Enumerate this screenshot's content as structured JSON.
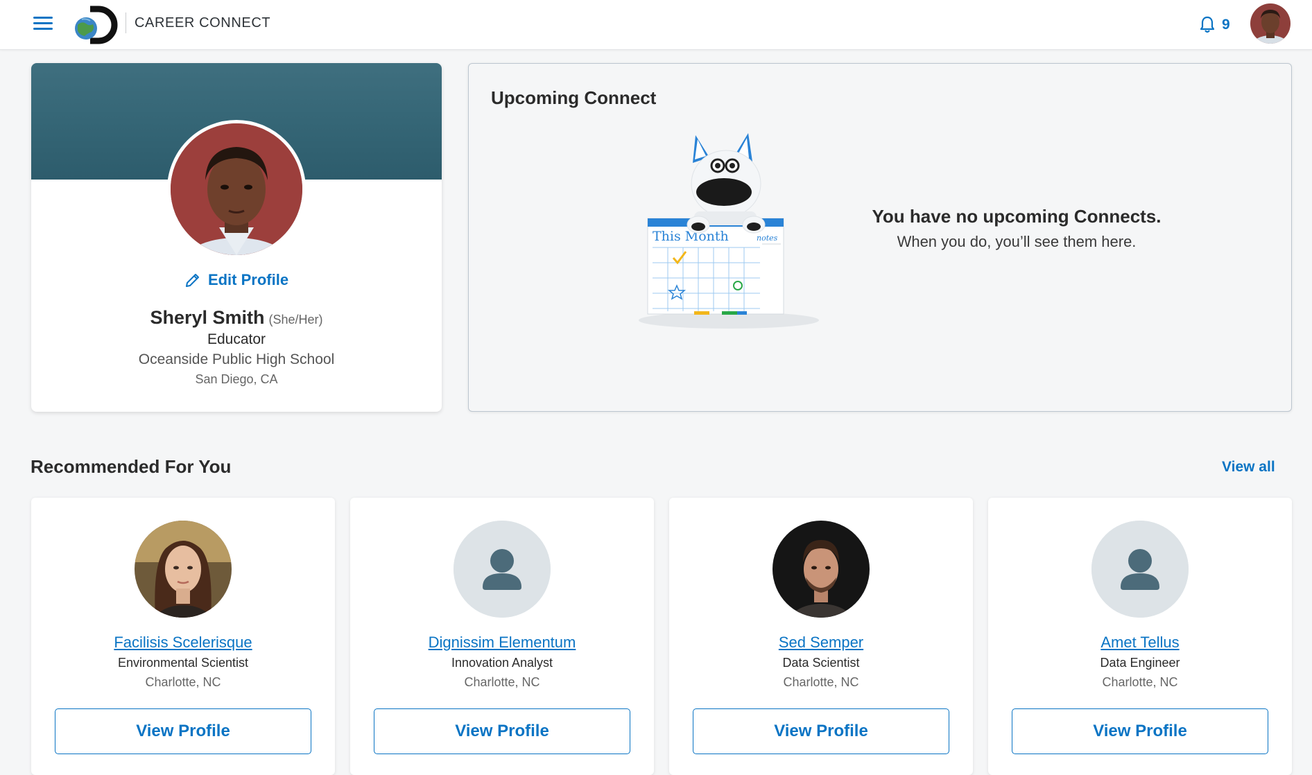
{
  "header": {
    "brand_name": "CAREER CONNECT",
    "notification_count": "9",
    "accent_color": "#0a74c4"
  },
  "profile": {
    "edit_label": "Edit Profile",
    "name": "Sheryl Smith",
    "pronouns": "(She/Her)",
    "role": "Educator",
    "school": "Oceanside Public High School",
    "location": "San Diego, CA"
  },
  "upcoming": {
    "title": "Upcoming Connect",
    "illustration_calendar_label": "This Month",
    "illustration_notes_label": "notes",
    "empty_title": "You have no upcoming Connects.",
    "empty_subtitle": "When you do, you’ll see them here."
  },
  "recommended": {
    "title": "Recommended For You",
    "view_all": "View all",
    "cards": [
      {
        "name": "Facilisis Scelerisque",
        "role": "Environmental Scientist",
        "location": "Charlotte, NC",
        "button": "View Profile",
        "avatar": "photo-woman"
      },
      {
        "name": "Dignissim Elementum",
        "role": "Innovation Analyst",
        "location": "Charlotte, NC",
        "button": "View Profile",
        "avatar": "placeholder-person-icon"
      },
      {
        "name": "Sed Semper",
        "role": "Data Scientist",
        "location": "Charlotte, NC",
        "button": "View Profile",
        "avatar": "photo-man"
      },
      {
        "name": "Amet Tellus",
        "role": "Data Engineer",
        "location": "Charlotte, NC",
        "button": "View Profile",
        "avatar": "placeholder-person-icon"
      }
    ]
  }
}
